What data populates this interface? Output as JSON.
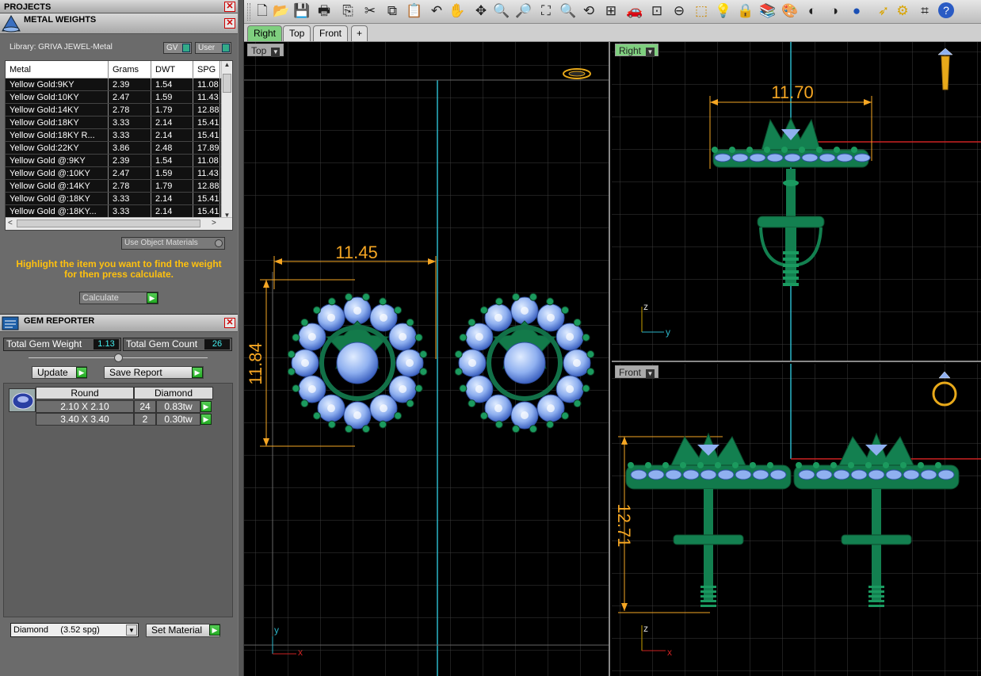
{
  "projects": {
    "title": "PROJECTS"
  },
  "metal_weights": {
    "title": "METAL WEIGHTS",
    "library": "Library: GRIVA JEWEL-Metal",
    "gv_label": "GV",
    "user_label": "User",
    "columns": [
      "Metal",
      "Grams",
      "DWT",
      "SPG"
    ],
    "rows": [
      [
        "Yellow Gold:9KY",
        "2.39",
        "1.54",
        "11.08"
      ],
      [
        "Yellow Gold:10KY",
        "2.47",
        "1.59",
        "11.43"
      ],
      [
        "Yellow Gold:14KY",
        "2.78",
        "1.79",
        "12.88"
      ],
      [
        "Yellow Gold:18KY",
        "3.33",
        "2.14",
        "15.41"
      ],
      [
        "Yellow Gold:18KY R...",
        "3.33",
        "2.14",
        "15.41"
      ],
      [
        "Yellow Gold:22KY",
        "3.86",
        "2.48",
        "17.89"
      ],
      [
        "Yellow Gold @:9KY",
        "2.39",
        "1.54",
        "11.08"
      ],
      [
        "Yellow Gold @:10KY",
        "2.47",
        "1.59",
        "11.43"
      ],
      [
        "Yellow Gold @:14KY",
        "2.78",
        "1.79",
        "12.88"
      ],
      [
        "Yellow Gold @:18KY",
        "3.33",
        "2.14",
        "15.41"
      ],
      [
        "Yellow Gold @:18KY...",
        "3.33",
        "2.14",
        "15.41"
      ]
    ],
    "use_object_materials": "Use Object Materials",
    "instruction": "Highlight the item you want to find the weight for then press calculate.",
    "calculate_label": "Calculate"
  },
  "gem_reporter": {
    "title": "GEM REPORTER",
    "total_weight_label": "Total Gem Weight",
    "total_weight": "1.13",
    "total_count_label": "Total Gem Count",
    "total_count": "26",
    "update_label": "Update",
    "save_label": "Save Report",
    "gem_columns": [
      "Round",
      "Diamond"
    ],
    "gems": [
      {
        "size": "2.10 X 2.10",
        "count": "24",
        "weight": "0.83tw"
      },
      {
        "size": "3.40 X 3.40",
        "count": "2",
        "weight": "0.30tw"
      }
    ],
    "material_select": "Diamond     (3.52 spg)",
    "set_material_label": "Set Material"
  },
  "tabs": [
    "Right",
    "Top",
    "Front",
    "+"
  ],
  "viewports": {
    "top": {
      "label": "Top",
      "dim_h": "11.45",
      "dim_v": "11.84",
      "axis_y": "y",
      "axis_x": "x"
    },
    "right": {
      "label": "Right",
      "dim_h": "11.70",
      "axis_z": "z",
      "axis_y": "y"
    },
    "front": {
      "label": "Front",
      "dim_v": "12.71",
      "axis_z": "z",
      "axis_x": "x"
    }
  }
}
